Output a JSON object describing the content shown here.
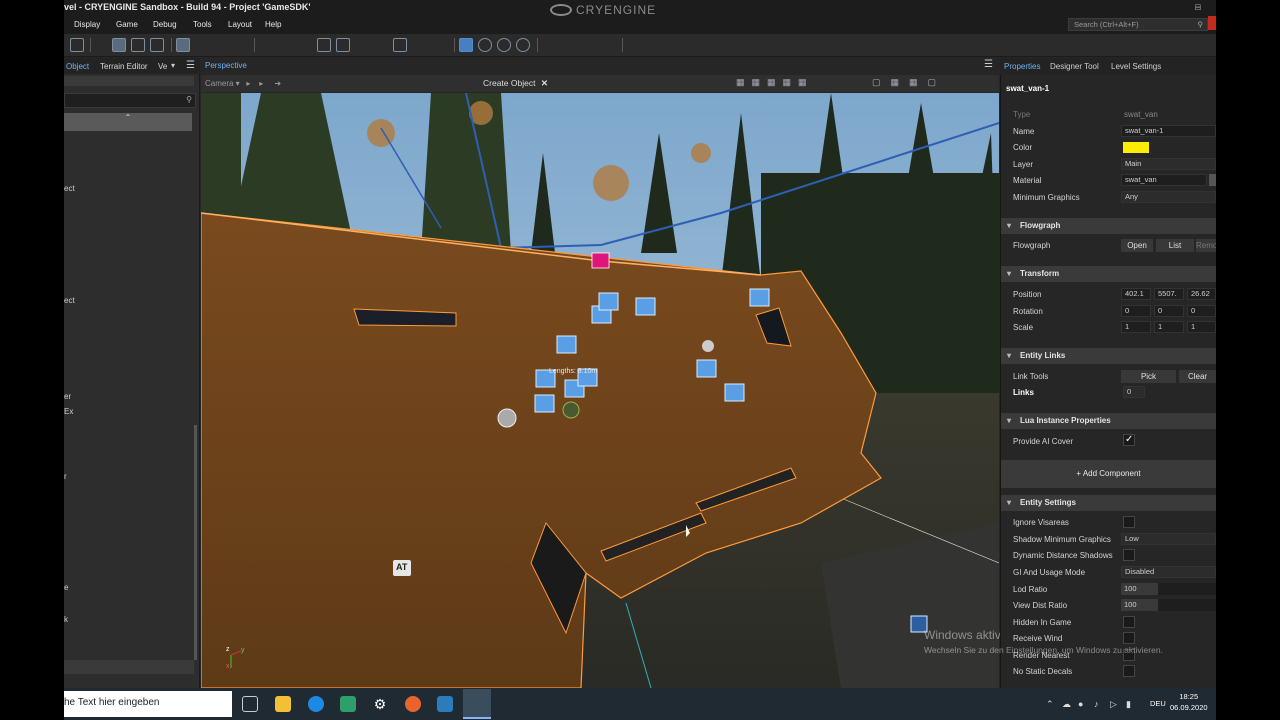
{
  "window": {
    "title": "vel - CRYENGINE Sandbox - Build 94 - Project 'GameSDK'",
    "logo_text": "CRYENGINE",
    "search_placeholder": "Search (Ctrl+Alt+F)",
    "controls": [
      "−",
      "□",
      "×"
    ]
  },
  "menu": [
    "Display",
    "Game",
    "Debug",
    "Tools",
    "Layout",
    "Help"
  ],
  "left_panel": {
    "tabs": [
      "Object",
      "Terrain Editor",
      "Ve"
    ],
    "rows": [
      "ect",
      "ect",
      "er",
      "Ex",
      "r",
      "e",
      "k"
    ]
  },
  "viewport": {
    "tab": "Perspective",
    "camera_label": "Camera",
    "create_object": "Create Object",
    "overlay_text": "Lengths: 8.10m",
    "icon_label_at": "AT",
    "axis_z": "z",
    "axis_y": "y",
    "axis_x": "x",
    "watermark_title": "Windows aktivieren",
    "watermark_sub": "Wechseln Sie zu den Einstellungen, um Windows zu aktivieren."
  },
  "properties": {
    "tabs": [
      "Properties",
      "Designer Tool",
      "Level Settings"
    ],
    "object_name": "swat_van-1",
    "fields": {
      "type_label": "Type",
      "type_value": "swat_van",
      "name_label": "Name",
      "name_value": "swat_van-1",
      "color_label": "Color",
      "color_value": "#ffee00",
      "layer_label": "Layer",
      "layer_value": "Main",
      "material_label": "Material",
      "material_value": "swat_van",
      "mingfx_label": "Minimum Graphics",
      "mingfx_value": "Any"
    },
    "flowgraph": {
      "section": "Flowgraph",
      "label": "Flowgraph",
      "open": "Open",
      "list": "List",
      "remove": "Remo"
    },
    "transform": {
      "section": "Transform",
      "position_label": "Position",
      "position": [
        "402.1",
        "5507.",
        "26.62"
      ],
      "rotation_label": "Rotation",
      "rotation": [
        "0",
        "0",
        "0"
      ],
      "scale_label": "Scale",
      "scale": [
        "1",
        "1",
        "1"
      ]
    },
    "entity_links": {
      "section": "Entity Links",
      "link_tools_label": "Link Tools",
      "pick": "Pick",
      "clear": "Clear",
      "links_label": "Links",
      "links_value": "0"
    },
    "lua": {
      "section": "Lua Instance Properties",
      "provide_ai_cover_label": "Provide AI Cover"
    },
    "add_component": "+ Add Component",
    "entity_settings": {
      "section": "Entity Settings",
      "ignore_visareas": "Ignore Visareas",
      "shadow_min_label": "Shadow Minimum Graphics",
      "shadow_min_value": "Low",
      "dynamic_shadows": "Dynamic Distance Shadows",
      "gi_label": "GI And Usage Mode",
      "gi_value": "Disabled",
      "lod_label": "Lod Ratio",
      "lod_value": "100",
      "lod_fill": 0.39,
      "viewdist_label": "View Dist Ratio",
      "viewdist_value": "100",
      "viewdist_fill": 0.39,
      "hidden_in_game": "Hidden In Game",
      "receive_wind": "Receive Wind",
      "render_nearest": "Render Nearest",
      "no_static_decals": "No Static Decals"
    }
  },
  "taskbar": {
    "search_placeholder": "he Text hier eingeben",
    "lang": "DEU",
    "time": "18:25",
    "date": "06.09.2020"
  }
}
